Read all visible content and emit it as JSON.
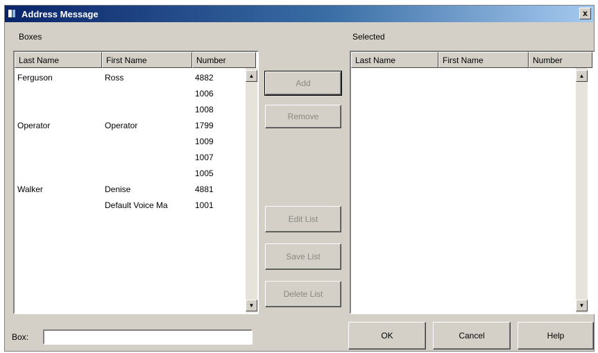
{
  "window": {
    "title": "Address Message",
    "close_label": "x"
  },
  "boxes": {
    "label": "Boxes",
    "columns": [
      "Last Name",
      "First Name",
      "Number"
    ],
    "rows": [
      [
        "Ferguson",
        "Ross",
        "4882"
      ],
      [
        "",
        "",
        "1006"
      ],
      [
        "",
        "",
        "1008"
      ],
      [
        "Operator",
        "Operator",
        "1799"
      ],
      [
        "",
        "",
        "1009"
      ],
      [
        "",
        "",
        "1007"
      ],
      [
        "",
        "",
        "1005"
      ],
      [
        "Walker",
        "Denise",
        "4881"
      ],
      [
        "",
        "Default Voice Ma",
        "1001"
      ]
    ]
  },
  "selected": {
    "label": "Selected",
    "columns": [
      "Last Name",
      "First Name",
      "Number"
    ],
    "rows": []
  },
  "buttons": {
    "add": "Add",
    "remove": "Remove",
    "edit_list": "Edit List",
    "save_list": "Save List",
    "delete_list": "Delete List",
    "ok": "OK",
    "cancel": "Cancel",
    "help": "Help"
  },
  "box_field": {
    "label": "Box:",
    "value": ""
  },
  "scroll": {
    "up": "▲",
    "down": "▼"
  }
}
